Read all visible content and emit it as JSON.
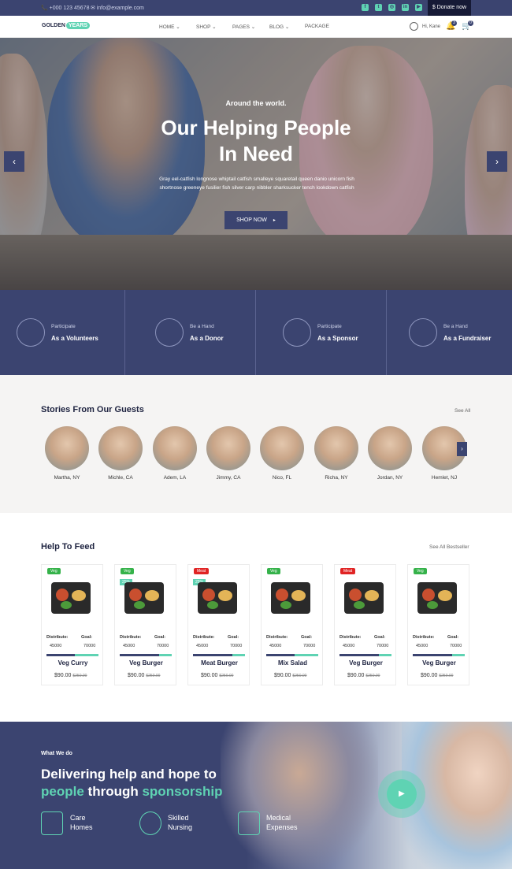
{
  "topbar": {
    "phone": "+000 123 45678",
    "email": "info@example.com",
    "social": [
      "f",
      "t",
      "ig",
      "in",
      "yt"
    ],
    "donate": "$ Donate now"
  },
  "nav": {
    "logo_a": "GOLDEN",
    "logo_b": "YEARS",
    "menu": [
      "HOME",
      "SHOP",
      "PAGES",
      "BLOG",
      "PACKAGE"
    ],
    "user": "Hi, Kane",
    "notif_count": "3",
    "cart_count": "0"
  },
  "hero": {
    "subtitle": "Around the world.",
    "title_1": "Our Helping People",
    "title_2": "In Need",
    "desc": "Gray eel-catfish longnose whiptail catfish smalleye squaretail queen danio unicorn fish shortnose greeneye fusilier fish silver carp nibbler sharksucker tench lookdown catfish",
    "button": "SHOP NOW"
  },
  "features": [
    {
      "small": "Participate",
      "big": "As a Volunteers"
    },
    {
      "small": "Be a Hand",
      "big": "As a Donor"
    },
    {
      "small": "Participate",
      "big": "As a Sponsor"
    },
    {
      "small": "Be a Hand",
      "big": "As a Fundraiser"
    }
  ],
  "stories": {
    "title": "Stories From Our Guests",
    "see_all": "See All",
    "guests": [
      "Martha, NY",
      "Michle, CA",
      "Adem, LA",
      "Jimmy, CA",
      "Nico, FL",
      "Richa, NY",
      "Jordan, NY",
      "Hemlet, NJ"
    ]
  },
  "feed": {
    "title": "Help To Feed",
    "see_all": "See All Bestseller",
    "products": [
      {
        "badge": "Veg",
        "badge_color": "#35b24a",
        "pct": "",
        "name": "Veg Curry",
        "distribute": "45000",
        "goal": "70000",
        "progress": 0.55,
        "price": "$90.00",
        "old_price": "$250.00"
      },
      {
        "badge": "Veg",
        "badge_color": "#35b24a",
        "pct": "25%",
        "name": "Veg Burger",
        "distribute": "45000",
        "goal": "70000",
        "progress": 0.75,
        "price": "$90.00",
        "old_price": "$250.00"
      },
      {
        "badge": "Meat",
        "badge_color": "#e02424",
        "pct": "25%",
        "name": "Meat Burger",
        "distribute": "45000",
        "goal": "70000",
        "progress": 0.75,
        "price": "$90.00",
        "old_price": "$250.00"
      },
      {
        "badge": "Veg",
        "badge_color": "#35b24a",
        "pct": "",
        "name": "Mix Salad",
        "distribute": "45000",
        "goal": "70000",
        "progress": 0.55,
        "price": "$90.00",
        "old_price": "$250.00"
      },
      {
        "badge": "Meat",
        "badge_color": "#e02424",
        "pct": "",
        "name": "Veg Burger",
        "distribute": "45000",
        "goal": "70000",
        "progress": 0.75,
        "price": "$90.00",
        "old_price": "$250.00"
      },
      {
        "badge": "Veg",
        "badge_color": "#35b24a",
        "pct": "",
        "name": "Veg Burger",
        "distribute": "45000",
        "goal": "70000",
        "progress": 0.75,
        "price": "$90.00",
        "old_price": "$250.00"
      }
    ],
    "distribute_label": "Distribute:",
    "goal_label": "Goal:"
  },
  "what": {
    "subtitle": "What We do",
    "line1": "Delivering help and hope to",
    "line2_a": "people",
    "line2_b": "through",
    "line2_c": "sponsorship",
    "services": [
      [
        "Care",
        "Homes"
      ],
      [
        "Skilled",
        "Nursing"
      ],
      [
        "Medical",
        "Expenses"
      ]
    ]
  },
  "colors": {
    "primary": "#3b4470",
    "accent": "#5fd3b3",
    "dark": "#161a36"
  }
}
